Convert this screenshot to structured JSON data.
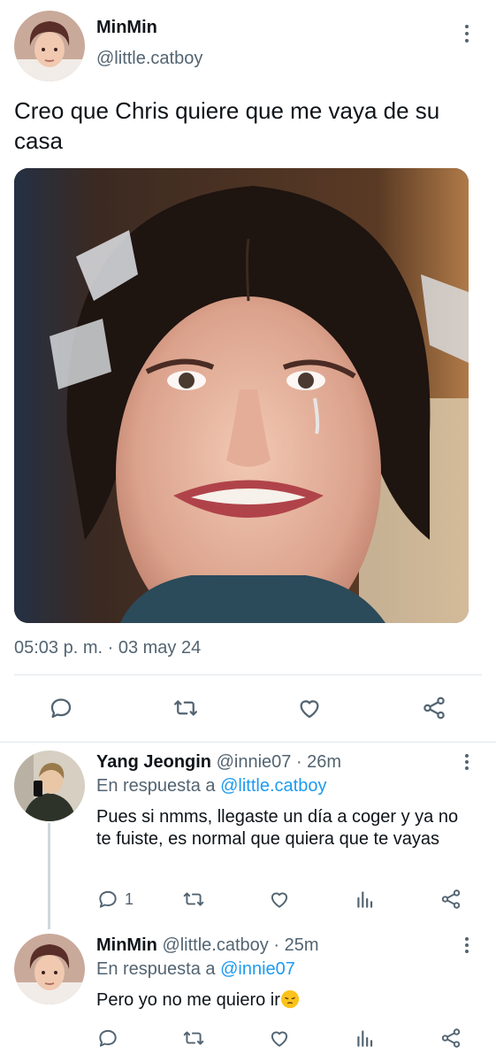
{
  "main_tweet": {
    "author_name": "MinMin",
    "author_handle": "@little.catboy",
    "text": "Creo que Chris quiere que me vaya de su casa",
    "timestamp": "05:03 p. m. · 03 may 24",
    "actions": [
      "reply-icon",
      "retweet-icon",
      "like-icon",
      "share-icon"
    ]
  },
  "replies": [
    {
      "author_name": "Yang Jeongin",
      "author_handle": "@innie07",
      "time": "· 26m",
      "in_reply_prefix": "En respuesta a ",
      "in_reply_mention": "@little.catboy",
      "text": "Pues si nmms, llegaste un día a coger y ya no te fuiste, es normal que quiera que te vayas",
      "reply_count": "1"
    },
    {
      "author_name": "MinMin",
      "author_handle": "@little.catboy",
      "time": "· 25m",
      "in_reply_prefix": "En respuesta a ",
      "in_reply_mention": "@innie07",
      "text": "Pero yo no me quiero ir",
      "emoji": "pensive-face-emoji",
      "reply_count": ""
    }
  ],
  "colors": {
    "text": "#0f1419",
    "secondary": "#536471",
    "link": "#1d9bf0",
    "divider": "#e1e6ea"
  }
}
